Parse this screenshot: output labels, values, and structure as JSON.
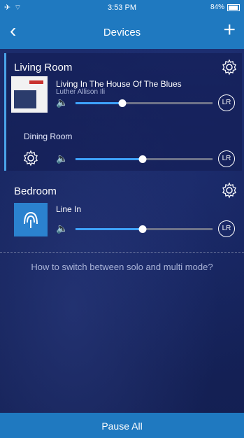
{
  "status_bar": {
    "left_icons": "✈ ⌔",
    "time": "3:53 PM",
    "right_text": "84%"
  },
  "nav": {
    "back_icon": "chevron-left-icon",
    "title": "Devices",
    "add_icon": "plus-icon"
  },
  "rooms": [
    {
      "name": "Living Room",
      "track_title": "Living In The House Of The Blues",
      "track_artist": "Luther Allison Ili",
      "volume_fraction": 0.34,
      "lr_label": "LR"
    },
    {
      "name": "Dining Room",
      "volume_fraction": 0.49,
      "lr_label": "LR"
    },
    {
      "name": "Bedroom",
      "input_label": "Line In",
      "volume_fraction": 0.49,
      "lr_label": "LR"
    }
  ],
  "help_text": "How to switch between solo and multi mode?",
  "bottom": {
    "pause_all": "Pause All"
  },
  "colors": {
    "accent": "#1f79c0",
    "slider_fill": "#3ea2ff",
    "slider_track": "#6e7389",
    "background": "#16245e"
  }
}
